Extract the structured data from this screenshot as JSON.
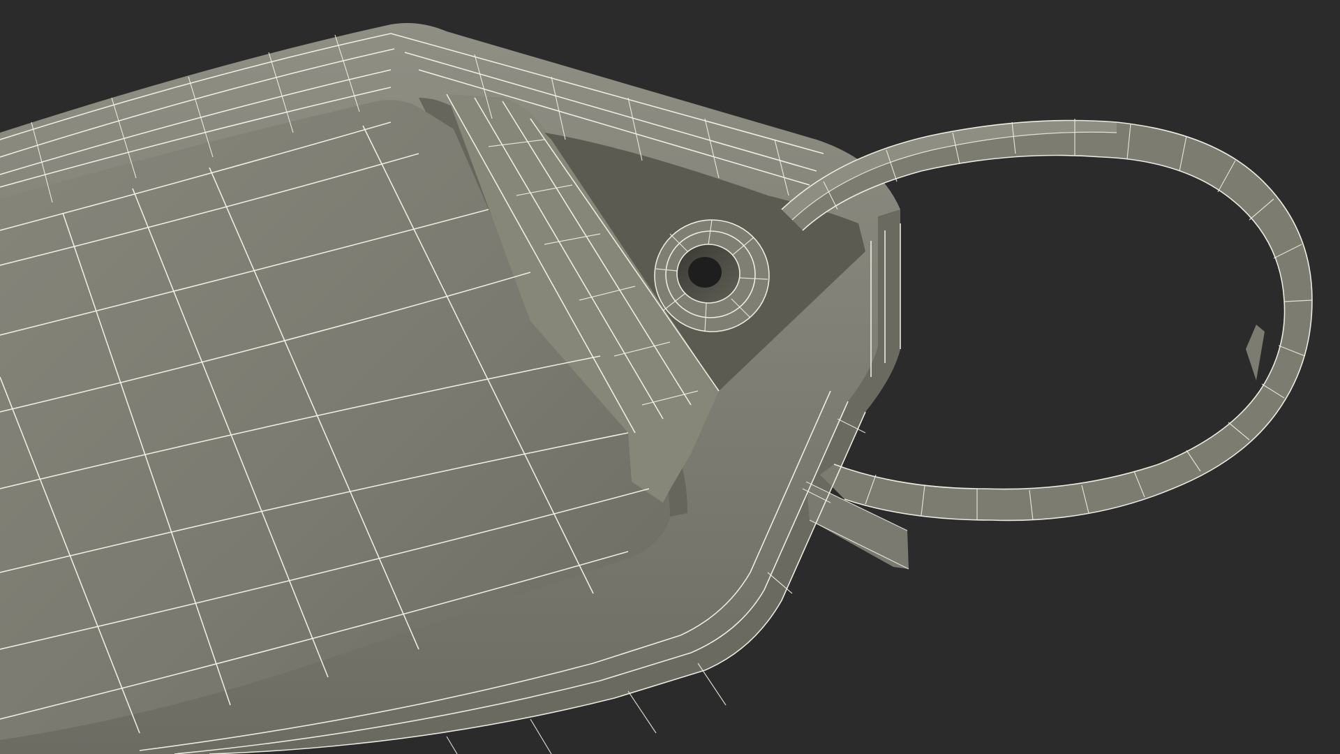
{
  "scene": {
    "subject": "keychain-tag-wireframe",
    "colors": {
      "background": "#2b2b2b",
      "mesh_base": "#7b7b70",
      "mesh_dark": "#5f5f56",
      "mesh_light": "#8a8a7f",
      "wire": "#f2f2e6"
    }
  }
}
